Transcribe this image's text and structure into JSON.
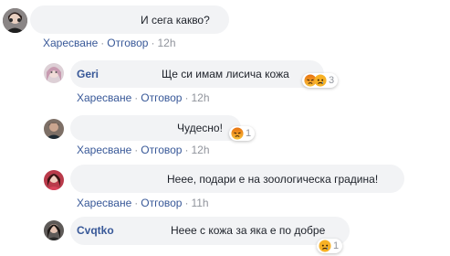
{
  "comments": [
    {
      "id": "c1",
      "name": "",
      "text": "И сега какво?",
      "actions": {
        "like": "Харесване",
        "reply": "Отговор",
        "time": "12h"
      },
      "reactions": null
    },
    {
      "id": "c2",
      "name": "Geri",
      "text": "Ще си имам лисича кожа",
      "actions": {
        "like": "Харесване",
        "reply": "Отговор",
        "time": "12h"
      },
      "reactions": {
        "icons": [
          "angry",
          "sad"
        ],
        "count": "3"
      }
    },
    {
      "id": "c3",
      "name": "",
      "text": "Чудесно!",
      "actions": {
        "like": "Харесване",
        "reply": "Отговор",
        "time": "12h"
      },
      "reactions": {
        "icons": [
          "angry"
        ],
        "count": "1"
      }
    },
    {
      "id": "c4",
      "name": "",
      "text": "Неее, подари е на зоологическа градина!",
      "actions": {
        "like": "Харесване",
        "reply": "Отговор",
        "time": "11h"
      },
      "reactions": null
    },
    {
      "id": "c5",
      "name": "Cvqtko",
      "text": "Неее с кожа за яка е по добре",
      "actions": {
        "like": "Харесване",
        "reply": "Отговор",
        "time": "11h"
      },
      "reactions": {
        "icons": [
          "sad"
        ],
        "count": "1"
      }
    }
  ],
  "colors": {
    "name": "#385898",
    "bubble": "#f2f3f5",
    "meta": "#90949c",
    "angry": "#e9710f",
    "sad": "#f7b125"
  }
}
